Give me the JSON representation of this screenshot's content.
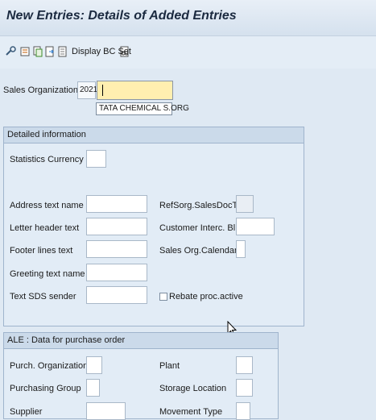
{
  "window": {
    "title": "New Entries: Details of Added Entries"
  },
  "toolbar": {
    "icons": [
      "settings-icon",
      "list-icon",
      "copy-icon",
      "export-icon",
      "document-icon",
      "glasses-icon"
    ],
    "display_bc_set": "Display BC Set"
  },
  "header": {
    "sales_org_label": "Sales Organization",
    "sales_org_value": "2021",
    "name_value": "",
    "suggestion": "TATA CHEMICAL S.ORG"
  },
  "detailed": {
    "title": "Detailed information",
    "statistics_currency": "Statistics Currency",
    "address_text_name": "Address text name",
    "letter_header_text": "Letter header text",
    "footer_lines_text": "Footer lines text",
    "greeting_text_name": "Greeting text name",
    "text_sds_sender": "Text SDS sender",
    "refsorg_salesdoctype": "RefSorg.SalesDocType",
    "customer_interc_bl": "Customer Interc. Bl.",
    "sales_org_calendar": "Sales Org.Calendar",
    "rebate_proc_active": "Rebate proc.active"
  },
  "ale": {
    "title": "ALE : Data for purchase order",
    "purch_organization": "Purch. Organization",
    "purchasing_group": "Purchasing Group",
    "supplier": "Supplier",
    "plant": "Plant",
    "storage_location": "Storage Location",
    "movement_type": "Movement Type"
  }
}
